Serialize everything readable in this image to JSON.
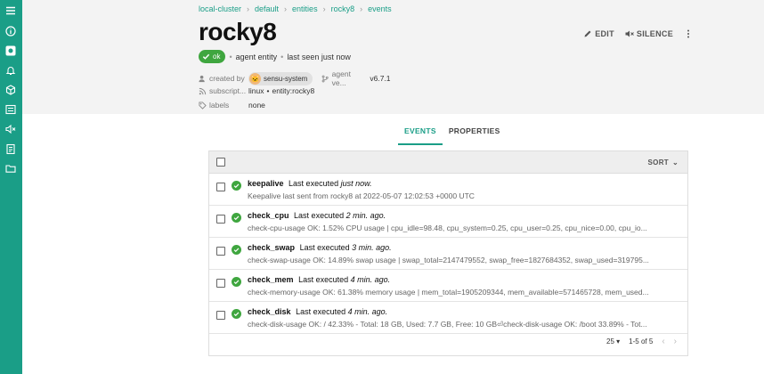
{
  "sidebar": {
    "icons": [
      "menu-icon",
      "info-icon",
      "dashboard-icon",
      "bell-icon",
      "box-icon",
      "list-icon",
      "silence-icon",
      "clipboard-icon",
      "folder-icon"
    ]
  },
  "breadcrumb": [
    "local-cluster",
    "default",
    "entities",
    "rocky8",
    "events"
  ],
  "entity": {
    "name": "rocky8",
    "status": "ok",
    "class_text": "agent entity",
    "last_seen": "last seen just now"
  },
  "actions": {
    "edit": "EDIT",
    "silence": "SILENCE"
  },
  "meta": {
    "created_by_label": "created by",
    "created_by_value": "sensu-system",
    "agent_version_label": "agent ve...",
    "agent_version_value": "v6.7.1",
    "subscriptions_label": "subscript...",
    "subscriptions": [
      "linux",
      "entity:rocky8"
    ],
    "labels_label": "labels",
    "labels_value": "none"
  },
  "tabs": {
    "events": "EVENTS",
    "properties": "PROPERTIES"
  },
  "events": {
    "sort_label": "SORT",
    "rows": [
      {
        "name": "keepalive",
        "prefix": "Last executed",
        "ago": "just now.",
        "output": "Keepalive last sent from rocky8 at 2022-05-07 12:02:53 +0000 UTC"
      },
      {
        "name": "check_cpu",
        "prefix": "Last executed",
        "ago": "2 min. ago.",
        "output": "check-cpu-usage OK: 1.52% CPU usage | cpu_idle=98.48, cpu_system=0.25, cpu_user=0.25, cpu_nice=0.00, cpu_io..."
      },
      {
        "name": "check_swap",
        "prefix": "Last executed",
        "ago": "3 min. ago.",
        "output": "check-swap-usage OK: 14.89% swap usage | swap_total=2147479552, swap_free=1827684352, swap_used=319795..."
      },
      {
        "name": "check_mem",
        "prefix": "Last executed",
        "ago": "4 min. ago.",
        "output": "check-memory-usage OK: 61.38% memory usage | mem_total=1905209344, mem_available=571465728, mem_used..."
      },
      {
        "name": "check_disk",
        "prefix": "Last executed",
        "ago": "4 min. ago.",
        "output": "check-disk-usage OK: / 42.33% - Total: 18 GB, Used: 7.7 GB, Free: 10 GB⏎check-disk-usage OK: /boot 33.89% - Tot..."
      }
    ],
    "per_page": "25",
    "range": "1-5 of 5"
  },
  "colors": {
    "accent": "#1a9e87",
    "ok": "#3fa63f"
  }
}
